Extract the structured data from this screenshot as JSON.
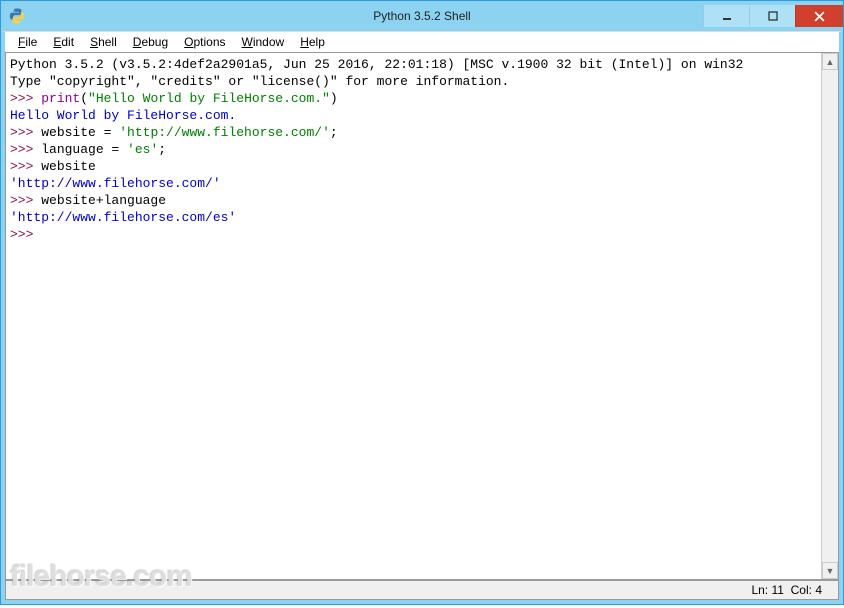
{
  "window": {
    "title": "Python 3.5.2 Shell"
  },
  "menubar": {
    "items": [
      {
        "label": "File",
        "accel": "F"
      },
      {
        "label": "Edit",
        "accel": "E"
      },
      {
        "label": "Shell",
        "accel": "S"
      },
      {
        "label": "Debug",
        "accel": "D"
      },
      {
        "label": "Options",
        "accel": "O"
      },
      {
        "label": "Window",
        "accel": "W"
      },
      {
        "label": "Help",
        "accel": "H"
      }
    ]
  },
  "shell": {
    "banner_line1": "Python 3.5.2 (v3.5.2:4def2a2901a5, Jun 25 2016, 22:01:18) [MSC v.1900 32 bit (Intel)] on win32",
    "banner_line2": "Type \"copyright\", \"credits\" or \"license()\" for more information.",
    "lines": [
      {
        "prompt": ">>> ",
        "parts": [
          {
            "cls": "c-builtin",
            "text": "print"
          },
          {
            "cls": "c-normal",
            "text": "("
          },
          {
            "cls": "c-string",
            "text": "\"Hello World by FileHorse.com.\""
          },
          {
            "cls": "c-normal",
            "text": ")"
          }
        ]
      },
      {
        "output": "Hello World by FileHorse.com."
      },
      {
        "prompt": ">>> ",
        "parts": [
          {
            "cls": "c-normal",
            "text": "website = "
          },
          {
            "cls": "c-string",
            "text": "'http://www.filehorse.com/'"
          },
          {
            "cls": "c-normal",
            "text": ";"
          }
        ]
      },
      {
        "prompt": ">>> ",
        "parts": [
          {
            "cls": "c-normal",
            "text": "language = "
          },
          {
            "cls": "c-string",
            "text": "'es'"
          },
          {
            "cls": "c-normal",
            "text": ";"
          }
        ]
      },
      {
        "prompt": ">>> ",
        "parts": [
          {
            "cls": "c-normal",
            "text": "website"
          }
        ]
      },
      {
        "output": "'http://www.filehorse.com/'"
      },
      {
        "prompt": ">>> ",
        "parts": [
          {
            "cls": "c-normal",
            "text": "website+language"
          }
        ]
      },
      {
        "output": "'http://www.filehorse.com/es'"
      },
      {
        "prompt": ">>> ",
        "parts": []
      }
    ]
  },
  "statusbar": {
    "ln_label": "Ln:",
    "ln_value": "11",
    "col_label": "Col:",
    "col_value": "4"
  },
  "watermark": "filehorse.com"
}
